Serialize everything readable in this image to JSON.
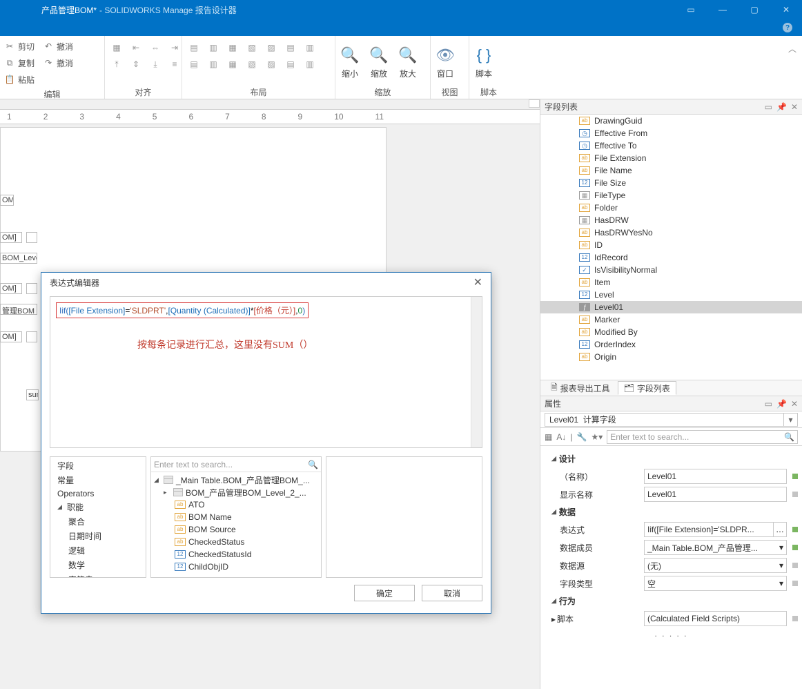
{
  "title": {
    "doc": "产品管理BOM*",
    "app": " - SOLIDWORKS Manage 报告设计器"
  },
  "ribbon": {
    "groups": {
      "edit": {
        "label": "编辑",
        "cut": "剪切",
        "copy": "复制",
        "paste": "粘贴",
        "undo": "撤消",
        "redo": "撤消"
      },
      "align": {
        "label": "对齐"
      },
      "layout": {
        "label": "布局"
      },
      "zoom": {
        "label": "缩放",
        "zoomOut": "缩小",
        "zoom": "缩放",
        "zoomIn": "放大"
      },
      "view": {
        "label": "视图",
        "window": "窗口"
      },
      "script": {
        "label": "脚本",
        "script": "脚本"
      }
    }
  },
  "ruler": {
    "ticks": [
      "1",
      "2",
      "3",
      "4",
      "5",
      "6",
      "7",
      "8",
      "9",
      "10",
      "11"
    ]
  },
  "surf": {
    "ph1": "OM",
    "ph2": "OM]",
    "ph3": "BOM_Level_",
    "ph4": "OM]",
    "ph5": "管理BOM_Lev",
    "ph6": "OM]",
    "ph7": "sum"
  },
  "dialog": {
    "title": "表达式编辑器",
    "expr": {
      "fn": "Iif(",
      "f1": "[File Extension]",
      "eq": "=",
      "s1": "'SLDPRT'",
      "c1": ",",
      "f2": "[Quantity (Calculated)]",
      "m": "*",
      "f3": "[价格（元）]",
      "c2": ",",
      "n": "0",
      "end": ")"
    },
    "annotation": "按每条记录进行汇总，这里没有SUM（）",
    "cats": {
      "fields": "字段",
      "consts": "常量",
      "ops": "Operators",
      "funcs": "职能",
      "agg": "聚合",
      "dt": "日期时间",
      "logic": "逻辑",
      "math": "数学",
      "str": "字符串"
    },
    "searchPlaceholder": "Enter text to search...",
    "tree": {
      "root": "_Main Table.BOM_产品管理BOM_...",
      "sub": "BOM_产品管理BOM_Level_2_...",
      "items": [
        "ATO",
        "BOM Name",
        "BOM Source",
        "CheckedStatus",
        "CheckedStatusId",
        "ChildObjID"
      ]
    },
    "ok": "确定",
    "cancel": "取消"
  },
  "fieldListTitle": "字段列表",
  "fields": [
    {
      "t": "ab",
      "n": "DrawingGuid"
    },
    {
      "t": "o",
      "n": "Effective From"
    },
    {
      "t": "o",
      "n": "Effective To"
    },
    {
      "t": "ab",
      "n": "File Extension"
    },
    {
      "t": "ab",
      "n": "File Name"
    },
    {
      "t": "12",
      "n": "File Size"
    },
    {
      "t": "g",
      "n": "FileType"
    },
    {
      "t": "ab",
      "n": "Folder"
    },
    {
      "t": "g",
      "n": "HasDRW"
    },
    {
      "t": "ab",
      "n": "HasDRWYesNo"
    },
    {
      "t": "ab",
      "n": "ID"
    },
    {
      "t": "12",
      "n": "IdRecord"
    },
    {
      "t": "ck",
      "n": "IsVisibilityNormal"
    },
    {
      "t": "ab",
      "n": "Item"
    },
    {
      "t": "12",
      "n": "Level"
    },
    {
      "t": "f",
      "n": "Level01",
      "sel": true
    },
    {
      "t": "ab",
      "n": "Marker"
    },
    {
      "t": "ab",
      "n": "Modified By"
    },
    {
      "t": "12",
      "n": "OrderIndex"
    },
    {
      "t": "ab",
      "n": "Origin"
    }
  ],
  "tabs": {
    "export": "报表导出工具",
    "fields": "字段列表"
  },
  "props": {
    "paneTitle": "属性",
    "head": "Level01  计算字段",
    "searchPlaceholder": "Enter text to search...",
    "design": {
      "cat": "设计",
      "nameLbl": "（名称）",
      "name": "Level01",
      "dispLbl": "显示名称",
      "disp": "Level01"
    },
    "data": {
      "cat": "数据",
      "exprLbl": "表达式",
      "expr": "Iif([File Extension]='SLDPR...",
      "memberLbl": "数据成员",
      "member": "_Main Table.BOM_产品管理...",
      "srcLbl": "数据源",
      "src": "(无)",
      "typeLbl": "字段类型",
      "type": "空"
    },
    "behavior": {
      "cat": "行为",
      "scriptLbl": "脚本",
      "script": "(Calculated Field Scripts)"
    }
  }
}
